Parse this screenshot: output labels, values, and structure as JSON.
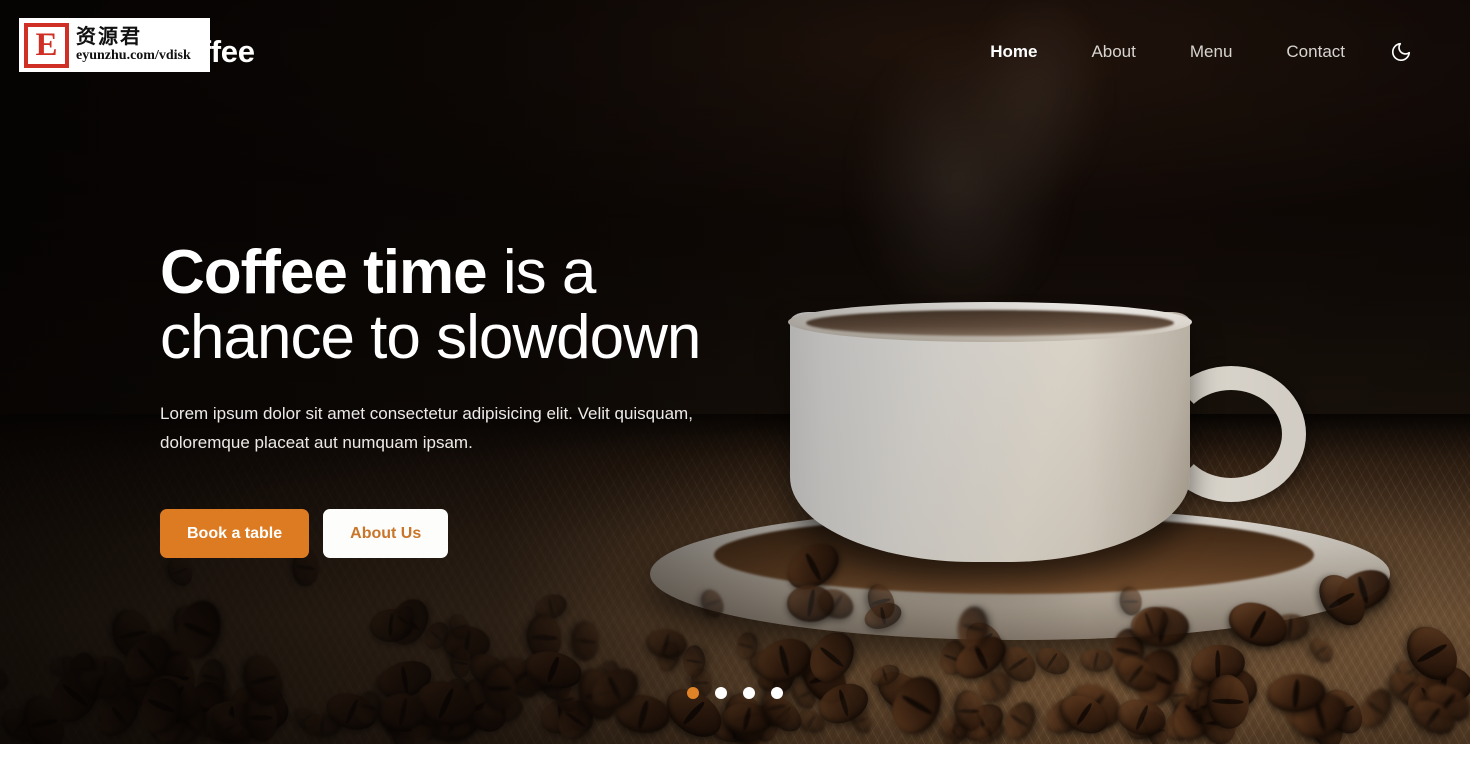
{
  "site": {
    "brand": "Coffee",
    "accent_color": "#dd7b22",
    "hero_background": "coffee-cup-on-burlap-with-beans"
  },
  "navbar": {
    "links": [
      {
        "label": "Home",
        "active": true,
        "name": "nav-link-home"
      },
      {
        "label": "About",
        "active": false,
        "name": "nav-link-about"
      },
      {
        "label": "Menu",
        "active": false,
        "name": "nav-link-menu"
      },
      {
        "label": "Contact",
        "active": false,
        "name": "nav-link-contact"
      }
    ],
    "theme_toggle_icon": "moon-icon"
  },
  "hero": {
    "title_accent": "Coffee time",
    "title_rest": " is a chance to slowdown",
    "subtitle": "Lorem ipsum dolor sit amet consectetur adipisicing elit. Velit quisquam, doloremque placeat aut numquam ipsam.",
    "primary_button": "Book a table",
    "secondary_button": "About Us"
  },
  "carousel": {
    "total_slides": 4,
    "active_slide": 1,
    "active_color": "#e08327",
    "inactive_color": "#ffffff"
  },
  "watermark": {
    "logo_letter": "E",
    "chinese_text": "资源君",
    "url": "eyunzhu.com/vdisk",
    "logo_color": "#cf2f24"
  }
}
